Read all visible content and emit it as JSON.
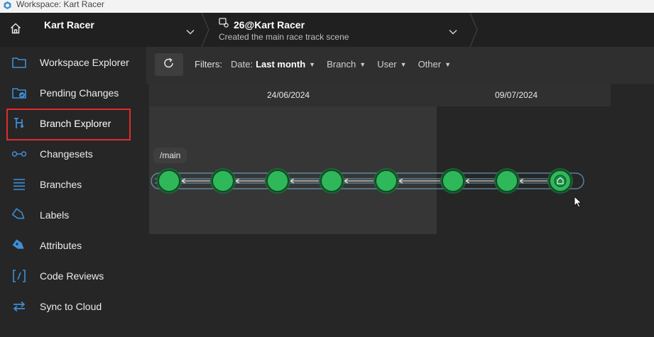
{
  "window": {
    "title": "Workspace: Kart Racer"
  },
  "header": {
    "repo_name": "Kart Racer",
    "changeset_id": "26@Kart Racer",
    "changeset_desc": "Created the main race track scene"
  },
  "sidebar": {
    "items": [
      {
        "label": "Workspace Explorer",
        "icon": "folder-icon"
      },
      {
        "label": "Pending Changes",
        "icon": "pending-changes-icon"
      },
      {
        "label": "Branch Explorer",
        "icon": "branch-explorer-icon"
      },
      {
        "label": "Changesets",
        "icon": "changesets-icon"
      },
      {
        "label": "Branches",
        "icon": "branches-list-icon"
      },
      {
        "label": "Labels",
        "icon": "label-tag-icon"
      },
      {
        "label": "Attributes",
        "icon": "attributes-tag-icon"
      },
      {
        "label": "Code Reviews",
        "icon": "code-review-icon"
      },
      {
        "label": "Sync to Cloud",
        "icon": "sync-icon"
      }
    ],
    "selected": "Branch Explorer"
  },
  "toolbar": {
    "filters_label": "Filters:",
    "date_label": "Date:",
    "date_value": "Last month",
    "branch_label": "Branch",
    "user_label": "User",
    "other_label": "Other"
  },
  "timeline": {
    "dates": [
      "24/06/2024",
      "09/07/2024"
    ],
    "branch_name": "/main",
    "changeset_count": 8,
    "head_index": 7
  },
  "colors": {
    "accent_green": "#2fb85a",
    "highlight_red": "#e32a2a",
    "link_blue": "#3d8fd6"
  }
}
